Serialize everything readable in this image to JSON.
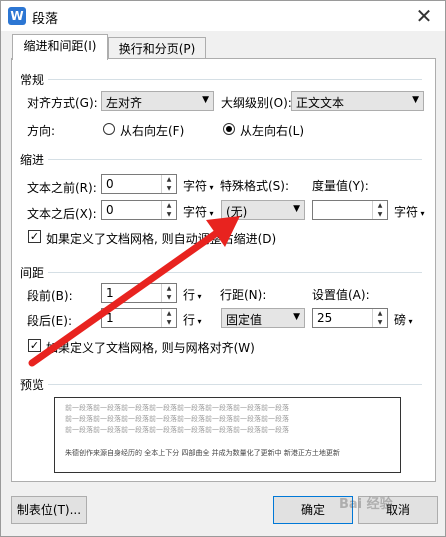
{
  "window": {
    "title": "段落",
    "app_icon": "W",
    "close": "✕"
  },
  "tabs": [
    {
      "label": "缩进和间距(I)"
    },
    {
      "label": "换行和分页(P)"
    }
  ],
  "general": {
    "group_title": "常规",
    "alignment_label": "对齐方式(G):",
    "alignment_value": "左对齐",
    "outline_label": "大纲级别(O):",
    "outline_value": "正文文本",
    "direction_label": "方向:",
    "rtl_label": "从右向左(F)",
    "ltr_label": "从左向右(L)",
    "selected_direction": "ltr"
  },
  "indent": {
    "group_title": "缩进",
    "before_label": "文本之前(R):",
    "before_value": "0",
    "before_unit": "字符",
    "after_label": "文本之后(X):",
    "after_value": "0",
    "after_unit": "字符",
    "special_label": "特殊格式(S):",
    "special_value": "(无)",
    "measure_label": "度量值(Y):",
    "measure_value": "",
    "measure_unit": "字符",
    "grid_checkbox_label": "如果定义了文档网格, 则自动调整右缩进(D)",
    "grid_checked": true
  },
  "spacing": {
    "group_title": "间距",
    "before_label": "段前(B):",
    "before_value": "1",
    "before_unit": "行",
    "after_label": "段后(E):",
    "after_value": "1",
    "after_unit": "行",
    "line_label": "行距(N):",
    "line_value": "固定值",
    "setting_label": "设置值(A):",
    "setting_value": "25",
    "setting_unit": "磅",
    "grid_checkbox_label": "如果定义了文档网格, 则与网格对齐(W)",
    "grid_checked": true
  },
  "preview": {
    "group_title": "预览",
    "sample_line": "前一段落前一段落前一段落前一段落前一段落前一段落前一段落前一段落",
    "sample_text": "朱德创作来源自身经历的    全本上下分    四部曲全    并成为数量化了更新中    新港正方土地更新"
  },
  "buttons": {
    "tabs": "制表位(T)...",
    "ok": "确定",
    "cancel": "取消"
  },
  "watermark": "Bai 经验",
  "colors": {
    "annotation_arrow": "#e8231f",
    "ok_border": "#0078d7"
  }
}
